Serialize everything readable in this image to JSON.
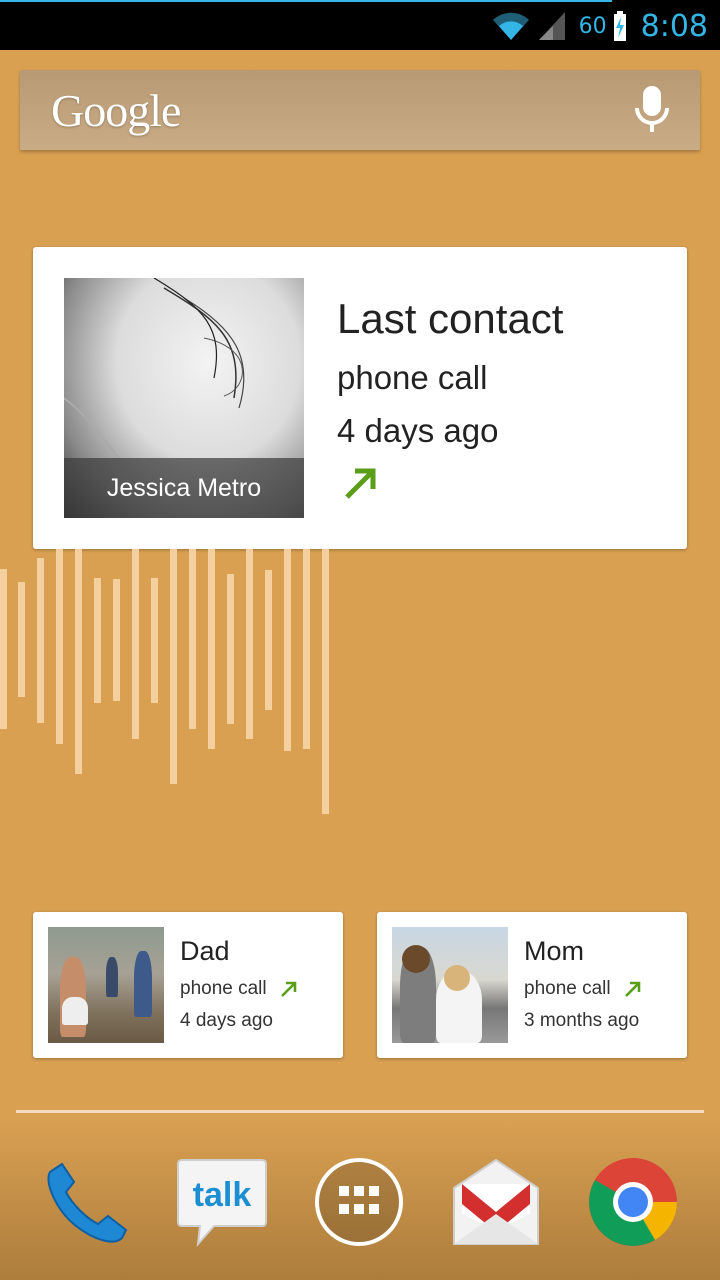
{
  "status_bar": {
    "battery_percent": "60",
    "time": "8:08",
    "icons": [
      "wifi-icon",
      "signal-icon",
      "battery-charging-icon"
    ],
    "accent_color": "#33b5e5"
  },
  "search": {
    "logo_text": "Google",
    "mic": "mic-icon"
  },
  "main_card": {
    "contact_name": "Jessica Metro",
    "title": "Last contact",
    "method": "phone call",
    "when": "4 days ago",
    "direction_icon": "outgoing-call-arrow-icon"
  },
  "contacts": [
    {
      "name": "Dad",
      "method": "phone call",
      "when": "4 days ago",
      "direction_icon": "outgoing-call-arrow-icon"
    },
    {
      "name": "Mom",
      "method": "phone call",
      "when": "3 months ago",
      "direction_icon": "outgoing-call-arrow-icon"
    }
  ],
  "dock": {
    "apps": [
      {
        "name": "Phone",
        "icon": "phone-icon"
      },
      {
        "name": "Talk",
        "icon": "talk-icon",
        "label": "talk"
      },
      {
        "name": "All apps",
        "icon": "app-drawer-icon"
      },
      {
        "name": "Gmail",
        "icon": "gmail-icon"
      },
      {
        "name": "Chrome",
        "icon": "chrome-icon"
      }
    ]
  },
  "colors": {
    "wallpaper": "#d9a052",
    "arrow_green": "#5a9e1a"
  }
}
